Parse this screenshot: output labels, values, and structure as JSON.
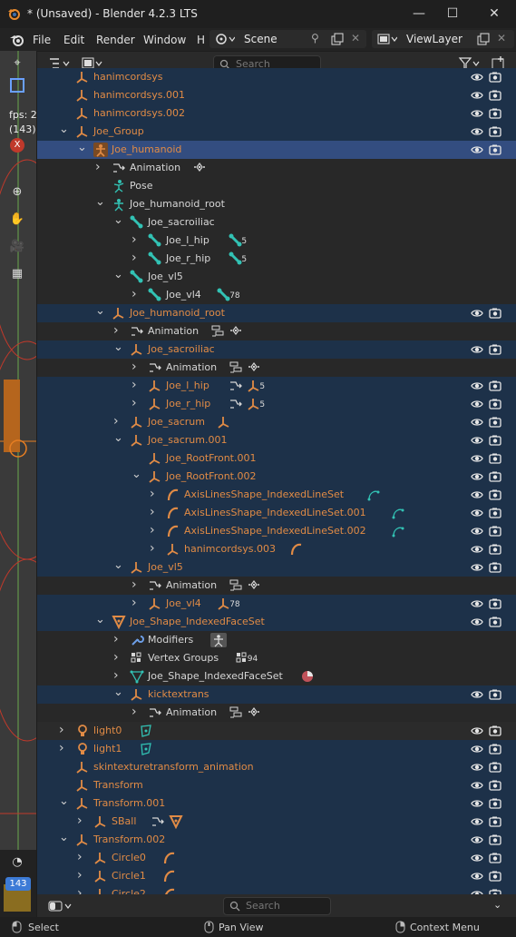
{
  "window": {
    "title": "* (Unsaved) - Blender 4.2.3 LTS",
    "minimize": "—",
    "maximize": "☐",
    "close": "✕"
  },
  "menubar": {
    "items": [
      "File",
      "Edit",
      "Render",
      "Window",
      "H"
    ],
    "scene": "Scene",
    "view_layer": "ViewLayer"
  },
  "viewport": {
    "fps_label": "fps: 2",
    "fps_count": "(143)",
    "frame": "143"
  },
  "outliner": {
    "search_placeholder": "Search",
    "footer_search_placeholder": "Search",
    "rows": [
      {
        "label": "hanimcordsys",
        "color": "orange",
        "indent": 1,
        "icon": "empty-icon",
        "arrow": "",
        "vis": true
      },
      {
        "label": "hanimcordsys.001",
        "color": "orange",
        "indent": 1,
        "icon": "empty-icon",
        "arrow": "",
        "vis": true
      },
      {
        "label": "hanimcordsys.002",
        "color": "orange",
        "indent": 1,
        "icon": "empty-icon",
        "arrow": "",
        "vis": true
      },
      {
        "label": "Joe_Group",
        "color": "orange",
        "indent": 1,
        "icon": "empty-icon",
        "arrow": "down",
        "vis": true
      },
      {
        "label": "Joe_humanoid",
        "color": "orange",
        "indent": 2,
        "icon": "armature-icon",
        "arrow": "down",
        "vis": true,
        "active": true
      },
      {
        "label": "Animation",
        "color": "white",
        "indent": 3,
        "icon": "animation-icon",
        "arrow": "right",
        "vis": false,
        "extra": [
          "action-icon"
        ]
      },
      {
        "label": "Pose",
        "color": "white",
        "indent": 3,
        "icon": "pose-icon",
        "arrow": "",
        "vis": false
      },
      {
        "label": "Joe_humanoid_root",
        "color": "white",
        "indent": 3,
        "icon": "armature-data-icon",
        "arrow": "down",
        "vis": false
      },
      {
        "label": "Joe_sacroiliac",
        "color": "white",
        "indent": 4,
        "icon": "bone-icon",
        "arrow": "down",
        "vis": false
      },
      {
        "label": "Joe_l_hip",
        "color": "white",
        "indent": 5,
        "icon": "bone-icon",
        "arrow": "right",
        "vis": false,
        "extra": [
          "bone-icon"
        ],
        "count": "5"
      },
      {
        "label": "Joe_r_hip",
        "color": "white",
        "indent": 5,
        "icon": "bone-icon",
        "arrow": "right",
        "vis": false,
        "extra": [
          "bone-icon"
        ],
        "count": "5"
      },
      {
        "label": "Joe_vl5",
        "color": "white",
        "indent": 4,
        "icon": "bone-icon",
        "arrow": "down",
        "vis": false
      },
      {
        "label": "Joe_vl4",
        "color": "white",
        "indent": 5,
        "icon": "bone-icon",
        "arrow": "right",
        "vis": false,
        "extra": [
          "bone-icon"
        ],
        "count": "78"
      },
      {
        "label": "Joe_humanoid_root",
        "color": "orange",
        "indent": 3,
        "icon": "empty-icon",
        "arrow": "down",
        "vis": true
      },
      {
        "label": "Animation",
        "color": "white",
        "indent": 4,
        "icon": "animation-icon",
        "arrow": "right",
        "vis": false,
        "extra": [
          "nla-icon",
          "action-icon"
        ]
      },
      {
        "label": "Joe_sacroiliac",
        "color": "orange",
        "indent": 4,
        "icon": "empty-icon",
        "arrow": "down",
        "vis": true
      },
      {
        "label": "Animation",
        "color": "white",
        "indent": 5,
        "icon": "animation-icon",
        "arrow": "right",
        "vis": false,
        "extra": [
          "nla-icon",
          "action-icon"
        ]
      },
      {
        "label": "Joe_l_hip",
        "color": "orange",
        "indent": 5,
        "icon": "empty-icon",
        "arrow": "right",
        "vis": true,
        "extra": [
          "animation-icon",
          "empty-icon"
        ],
        "count": "5"
      },
      {
        "label": "Joe_r_hip",
        "color": "orange",
        "indent": 5,
        "icon": "empty-icon",
        "arrow": "right",
        "vis": true,
        "extra": [
          "animation-icon",
          "empty-icon"
        ],
        "count": "5"
      },
      {
        "label": "Joe_sacrum",
        "color": "orange",
        "indent": 4,
        "icon": "empty-icon",
        "arrow": "right",
        "vis": true,
        "extra": [
          "empty-icon"
        ]
      },
      {
        "label": "Joe_sacrum.001",
        "color": "orange",
        "indent": 4,
        "icon": "empty-icon",
        "arrow": "down",
        "vis": true
      },
      {
        "label": "Joe_RootFront.001",
        "color": "orange",
        "indent": 5,
        "icon": "empty-icon",
        "arrow": "",
        "vis": true
      },
      {
        "label": "Joe_RootFront.002",
        "color": "orange",
        "indent": 5,
        "icon": "empty-icon",
        "arrow": "down",
        "vis": true
      },
      {
        "label": "AxisLinesShape_IndexedLineSet",
        "color": "orange",
        "indent": 6,
        "icon": "curve-icon",
        "arrow": "right",
        "vis": true,
        "extra": [
          "curve-data-icon"
        ]
      },
      {
        "label": "AxisLinesShape_IndexedLineSet.001",
        "color": "orange",
        "indent": 6,
        "icon": "curve-icon",
        "arrow": "right",
        "vis": true,
        "extra": [
          "curve-data-icon"
        ]
      },
      {
        "label": "AxisLinesShape_IndexedLineSet.002",
        "color": "orange",
        "indent": 6,
        "icon": "curve-icon",
        "arrow": "right",
        "vis": true,
        "extra": [
          "curve-data-icon"
        ]
      },
      {
        "label": "hanimcordsys.003",
        "color": "orange",
        "indent": 6,
        "icon": "empty-icon",
        "arrow": "right",
        "vis": true,
        "extra": [
          "curve-icon"
        ]
      },
      {
        "label": "Joe_vl5",
        "color": "orange",
        "indent": 4,
        "icon": "empty-icon",
        "arrow": "down",
        "vis": true
      },
      {
        "label": "Animation",
        "color": "white",
        "indent": 5,
        "icon": "animation-icon",
        "arrow": "right",
        "vis": false,
        "extra": [
          "nla-icon",
          "action-icon"
        ]
      },
      {
        "label": "Joe_vl4",
        "color": "orange",
        "indent": 5,
        "icon": "empty-icon",
        "arrow": "right",
        "vis": true,
        "extra": [
          "empty-icon"
        ],
        "count": "78"
      },
      {
        "label": "Joe_Shape_IndexedFaceSet",
        "color": "orange",
        "indent": 3,
        "icon": "mesh-icon",
        "arrow": "down",
        "vis": true
      },
      {
        "label": "Modifiers",
        "color": "white",
        "indent": 4,
        "icon": "wrench-icon",
        "arrow": "right",
        "vis": false,
        "extra": [
          "armature-modifier-icon"
        ]
      },
      {
        "label": "Vertex Groups",
        "color": "white",
        "indent": 4,
        "icon": "vertex-groups-icon",
        "arrow": "right",
        "vis": false,
        "extra": [
          "vertex-groups-icon"
        ],
        "count": "94"
      },
      {
        "label": "Joe_Shape_IndexedFaceSet",
        "color": "white",
        "indent": 4,
        "icon": "mesh-data-icon",
        "arrow": "right",
        "vis": false,
        "extra": [
          "material-icon"
        ]
      },
      {
        "label": "kicktextrans",
        "color": "orange",
        "indent": 4,
        "icon": "empty-icon",
        "arrow": "down",
        "vis": true
      },
      {
        "label": "Animation",
        "color": "white",
        "indent": 5,
        "icon": "animation-icon",
        "arrow": "right",
        "vis": false,
        "extra": [
          "nla-icon",
          "action-icon"
        ]
      },
      {
        "label": "light0",
        "color": "orange",
        "indent": 1,
        "icon": "light-icon",
        "arrow": "right",
        "vis": true,
        "extra": [
          "light-data-icon"
        ],
        "alt": true
      },
      {
        "label": "light1",
        "color": "orange",
        "indent": 1,
        "icon": "light-icon",
        "arrow": "right",
        "vis": true,
        "extra": [
          "light-data-icon"
        ]
      },
      {
        "label": "skintexturetransform_animation",
        "color": "orange",
        "indent": 1,
        "icon": "empty-icon",
        "arrow": "",
        "vis": true
      },
      {
        "label": "Transform",
        "color": "orange",
        "indent": 1,
        "icon": "empty-icon",
        "arrow": "",
        "vis": true
      },
      {
        "label": "Transform.001",
        "color": "orange",
        "indent": 1,
        "icon": "empty-icon",
        "arrow": "down",
        "vis": true
      },
      {
        "label": "SBall",
        "color": "orange",
        "indent": 2,
        "icon": "empty-icon",
        "arrow": "right",
        "vis": true,
        "extra": [
          "animation-icon",
          "mesh-icon"
        ]
      },
      {
        "label": "Transform.002",
        "color": "orange",
        "indent": 1,
        "icon": "empty-icon",
        "arrow": "down",
        "vis": true
      },
      {
        "label": "Circle0",
        "color": "orange",
        "indent": 2,
        "icon": "empty-icon",
        "arrow": "right",
        "vis": true,
        "extra": [
          "curve-icon"
        ]
      },
      {
        "label": "Circle1",
        "color": "orange",
        "indent": 2,
        "icon": "empty-icon",
        "arrow": "right",
        "vis": true,
        "extra": [
          "curve-icon"
        ]
      },
      {
        "label": "Circle2",
        "color": "orange",
        "indent": 2,
        "icon": "empty-icon",
        "arrow": "right",
        "vis": true,
        "extra": [
          "curve-icon"
        ]
      }
    ]
  },
  "statusbar": {
    "select": "Select",
    "pan": "Pan View",
    "context": "Context Menu"
  }
}
